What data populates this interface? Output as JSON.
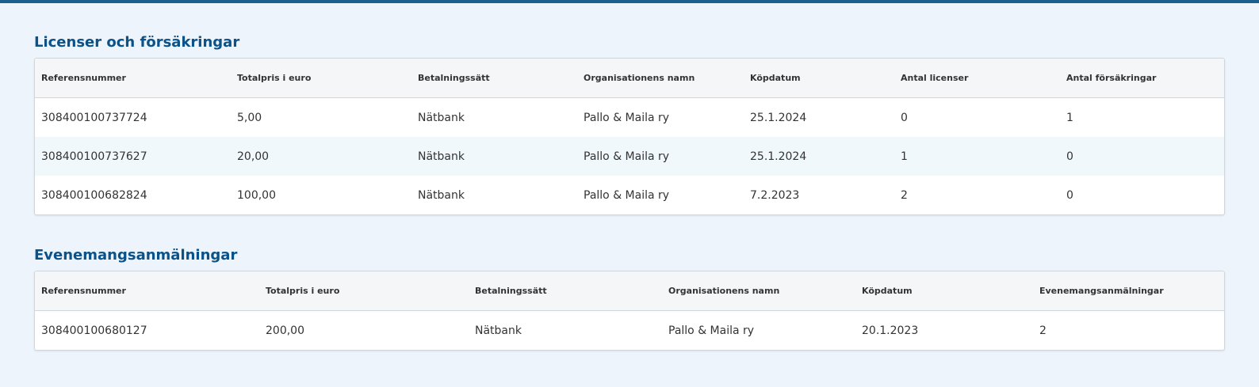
{
  "licenses": {
    "title": "Licenser och försäkringar",
    "columns": [
      "Referensnummer",
      "Totalpris i euro",
      "Betalningssätt",
      "Organisationens namn",
      "Köpdatum",
      "Antal licenser",
      "Antal försäkringar"
    ],
    "rows": [
      [
        "308400100737724",
        "5,00",
        "Nätbank",
        "Pallo & Maila ry",
        "25.1.2024",
        "0",
        "1"
      ],
      [
        "308400100737627",
        "20,00",
        "Nätbank",
        "Pallo & Maila ry",
        "25.1.2024",
        "1",
        "0"
      ],
      [
        "308400100682824",
        "100,00",
        "Nätbank",
        "Pallo & Maila ry",
        "7.2.2023",
        "2",
        "0"
      ]
    ]
  },
  "events": {
    "title": "Evenemangsanmälningar",
    "columns": [
      "Referensnummer",
      "Totalpris i euro",
      "Betalningssätt",
      "Organisationens namn",
      "Köpdatum",
      "Evenemangsanmälningar"
    ],
    "rows": [
      [
        "308400100680127",
        "200,00",
        "Nätbank",
        "Pallo & Maila ry",
        "20.1.2023",
        "2"
      ]
    ]
  },
  "colors": {
    "accent": "#1b5f8c",
    "title": "#0b5288",
    "background": "#edf4fb",
    "row_alt": "#f1f8fb"
  }
}
